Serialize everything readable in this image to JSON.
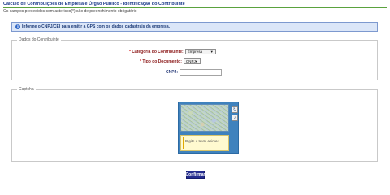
{
  "page": {
    "title": "Cálculo de Contribuições de Empresa e Órgão Público - Identificação do Contribuinte",
    "subtitle": "Os campos precedidos com asterisco(*) são de preenchimento obrigatório"
  },
  "info": {
    "icon": "info-icon",
    "text": "Informe o CNPJ/CEI para emitir a GPS com os dados cadastrais da empresa."
  },
  "dados": {
    "legend": "Dados do Contribuinte",
    "categoria": {
      "required": "*",
      "label": "Categoria do Contribuinte:",
      "value": "Empresa"
    },
    "tipo_documento": {
      "required": "*",
      "label": "Tipo do Documento:",
      "value": "CNPJ"
    },
    "cnpj": {
      "label": "CNPJ:",
      "value": ""
    }
  },
  "captcha": {
    "legend": "Captcha",
    "answer_placeholder": "Digite o texto acima:",
    "refresh_icon": "refresh-icon",
    "audio_icon": "audio-icon"
  },
  "actions": {
    "confirm_label": "Confirmar"
  },
  "colors": {
    "title": "#1a3a8a",
    "rule": "#5aa23e",
    "info_bg": "#dbe6f8",
    "captcha_panel": "#3f82bd",
    "confirm_bg": "#242c8e"
  }
}
